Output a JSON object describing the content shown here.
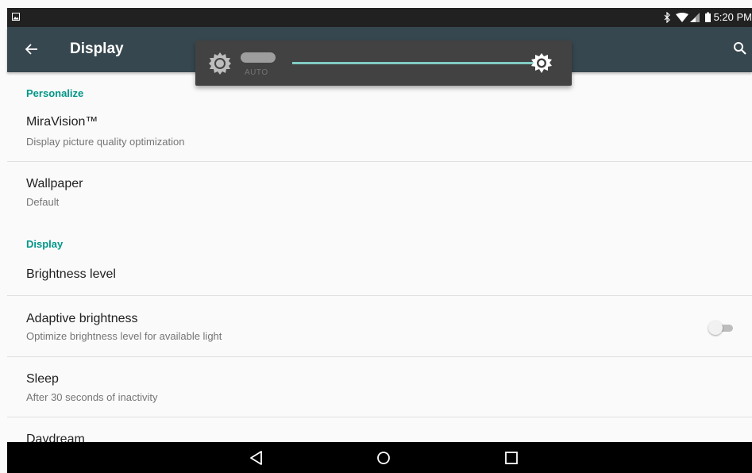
{
  "status_bar": {
    "time": "5:20 PM",
    "icons": [
      "gallery-icon",
      "bluetooth-icon",
      "wifi-icon",
      "signal-icon",
      "battery-icon"
    ]
  },
  "app_bar": {
    "title": "Display",
    "icons": [
      "back-arrow-icon",
      "search-icon"
    ]
  },
  "brightness_popup": {
    "auto_label": "AUTO",
    "auto_enabled": false,
    "level": 1.0,
    "icons": [
      "brightness-auto-sun-icon",
      "brightness-thumb-icon"
    ]
  },
  "sections": {
    "personalize": {
      "header": "Personalize",
      "miravision": {
        "title": "MiraVision™",
        "subtitle": "Display picture quality optimization"
      },
      "wallpaper": {
        "title": "Wallpaper",
        "subtitle": "Default"
      }
    },
    "display": {
      "header": "Display",
      "brightness": {
        "title": "Brightness level"
      },
      "adaptive": {
        "title": "Adaptive brightness",
        "subtitle": "Optimize brightness level for available light",
        "enabled": false
      },
      "sleep": {
        "title": "Sleep",
        "subtitle": "After 30 seconds of inactivity"
      },
      "daydream": {
        "title": "Daydream"
      }
    }
  },
  "nav_bar": {
    "icons": [
      "back-triangle-icon",
      "home-circle-icon",
      "recents-square-icon"
    ]
  },
  "colors": {
    "accent": "#009688",
    "app_bar": "#37474f",
    "status_bar": "#212121",
    "background": "#fafafa",
    "slider": "#80cbc4"
  }
}
